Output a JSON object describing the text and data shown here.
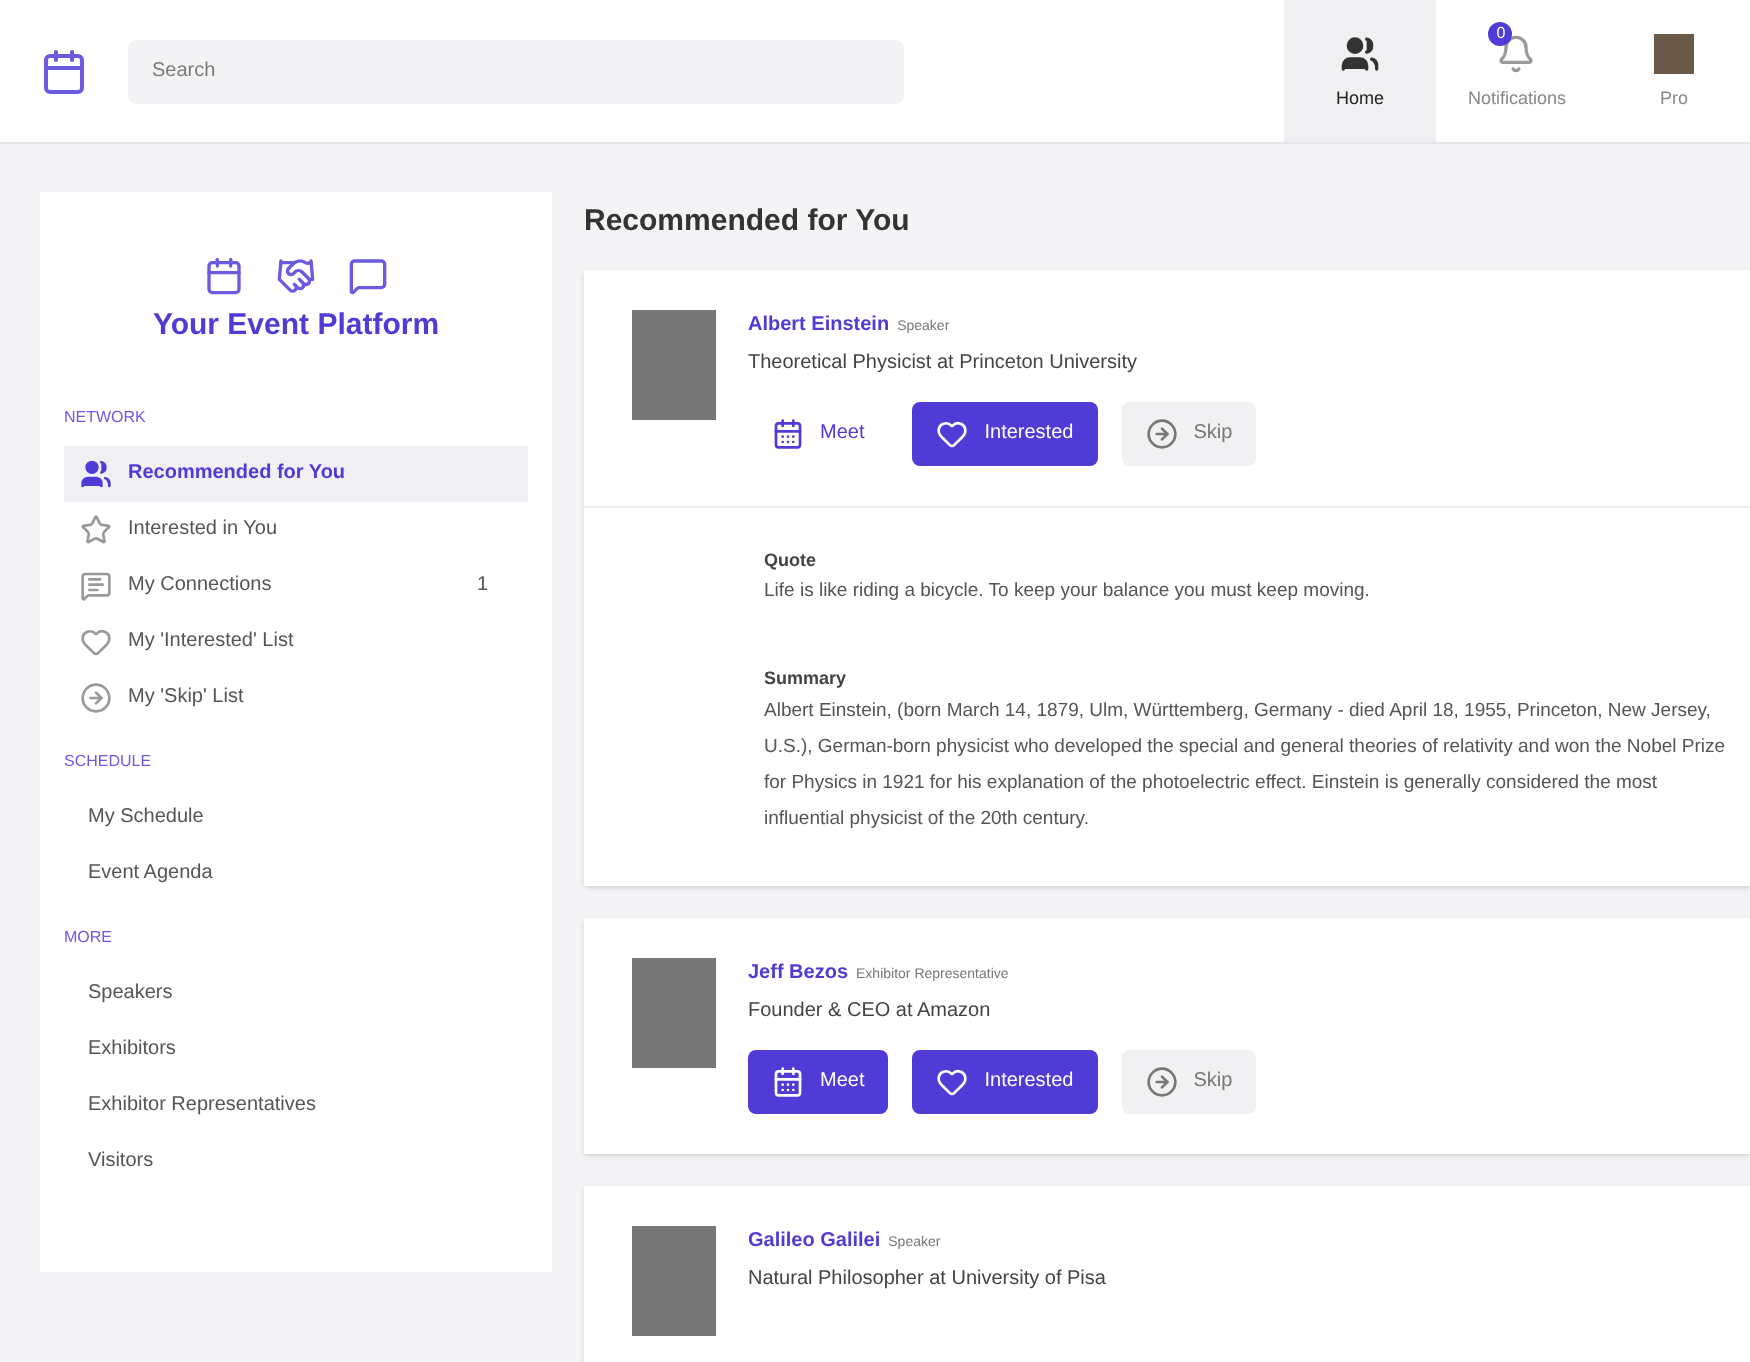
{
  "header": {
    "search": {
      "placeholder": "Search"
    },
    "nav": [
      {
        "label": "Home",
        "selected": true,
        "kind": "home"
      },
      {
        "label": "Notifications",
        "selected": false,
        "kind": "bell",
        "badge": "0"
      },
      {
        "label": "Pro",
        "selected": false,
        "kind": "photo"
      }
    ]
  },
  "sidebar": {
    "title": "Your Event Platform",
    "sections": [
      {
        "heading": "NETWORK",
        "items": [
          {
            "label": "Recommended for You",
            "kind": "people",
            "selected": true
          },
          {
            "label": "Interested in You",
            "kind": "star",
            "selected": false
          },
          {
            "label": "My Connections",
            "kind": "chat",
            "selected": false,
            "count": "1"
          },
          {
            "label": "My 'Interested' List",
            "kind": "heart",
            "selected": false
          },
          {
            "label": "My 'Skip' List",
            "kind": "skip",
            "selected": false
          }
        ]
      },
      {
        "heading": "SCHEDULE",
        "items": [
          {
            "label": "My Schedule",
            "selected": false
          },
          {
            "label": "Event Agenda",
            "selected": false
          }
        ]
      },
      {
        "heading": "MORE",
        "items": [
          {
            "label": "Speakers",
            "selected": false
          },
          {
            "label": "Exhibitors",
            "selected": false
          },
          {
            "label": "Exhibitor Representatives",
            "selected": false
          },
          {
            "label": "Visitors",
            "selected": false
          }
        ]
      }
    ]
  },
  "main": {
    "heading": "Recommended for You",
    "people": [
      {
        "name": "Albert Einstein",
        "role": "Speaker",
        "title": "Theoretical Physicist at Princeton University",
        "buttons": [
          {
            "label": "Meet",
            "kind": "meet",
            "filled": false
          },
          {
            "label": "Interested",
            "kind": "interested",
            "filled": true
          },
          {
            "label": "Skip",
            "kind": "skip",
            "filled": false
          }
        ],
        "details": [
          {
            "label": "Quote",
            "text": "Life is like riding a bicycle. To keep your balance you must keep moving."
          },
          {
            "label": "Summary",
            "text": "Albert Einstein, (born March 14, 1879, Ulm, Württemberg, Germany - died April 18, 1955, Princeton, New Jersey, U.S.), German-born physicist who developed the special and general theories of relativity and won the Nobel Prize for Physics in 1921 for his explanation of the photoelectric effect. Einstein is generally considered the most influential physicist of the 20th century."
          }
        ]
      },
      {
        "name": "Jeff Bezos",
        "role": "Exhibitor Representative",
        "title": "Founder & CEO at Amazon",
        "buttons": [
          {
            "label": "Meet",
            "kind": "meet",
            "filled": true
          },
          {
            "label": "Interested",
            "kind": "interested",
            "filled": true
          },
          {
            "label": "Skip",
            "kind": "skip",
            "filled": false
          }
        ]
      },
      {
        "name": "Galileo Galilei",
        "role": "Speaker",
        "title": "Natural Philosopher at University of Pisa"
      }
    ]
  }
}
